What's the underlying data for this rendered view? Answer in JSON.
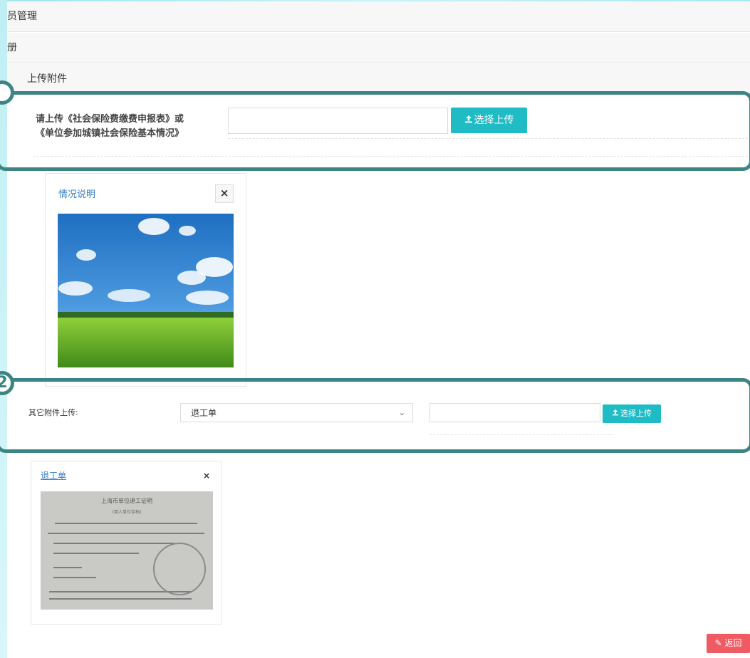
{
  "nav": {
    "item1": "员管理",
    "item2": "册",
    "item3": "上传附件"
  },
  "step1": {
    "badge": "",
    "label_line1": "请上传《社会保险费缴费申报表》或",
    "label_line2": "《单位参加城镇社会保险基本情况》",
    "file_value": "",
    "upload_label": "选择上传"
  },
  "card1": {
    "title": "情况说明",
    "close_label": "×"
  },
  "step2": {
    "badge": "2",
    "label": "其它附件上传:",
    "select_value": "退工单",
    "file_value": "",
    "upload_label": "选择上传"
  },
  "card2": {
    "title": "退工单",
    "close_label": "×",
    "doc_title": "上海市单位退工证明",
    "doc_subtitle": "(用人单位存档)"
  },
  "footer": {
    "back_label": "返回"
  },
  "icons": {
    "upload": "upload-icon",
    "close": "close-icon",
    "chevron": "chevron-down-icon",
    "back": "eraser-icon"
  },
  "colors": {
    "accent": "#20bcc6",
    "frame": "#3d8585",
    "link": "#3a7fc4",
    "danger": "#ef5a63"
  }
}
